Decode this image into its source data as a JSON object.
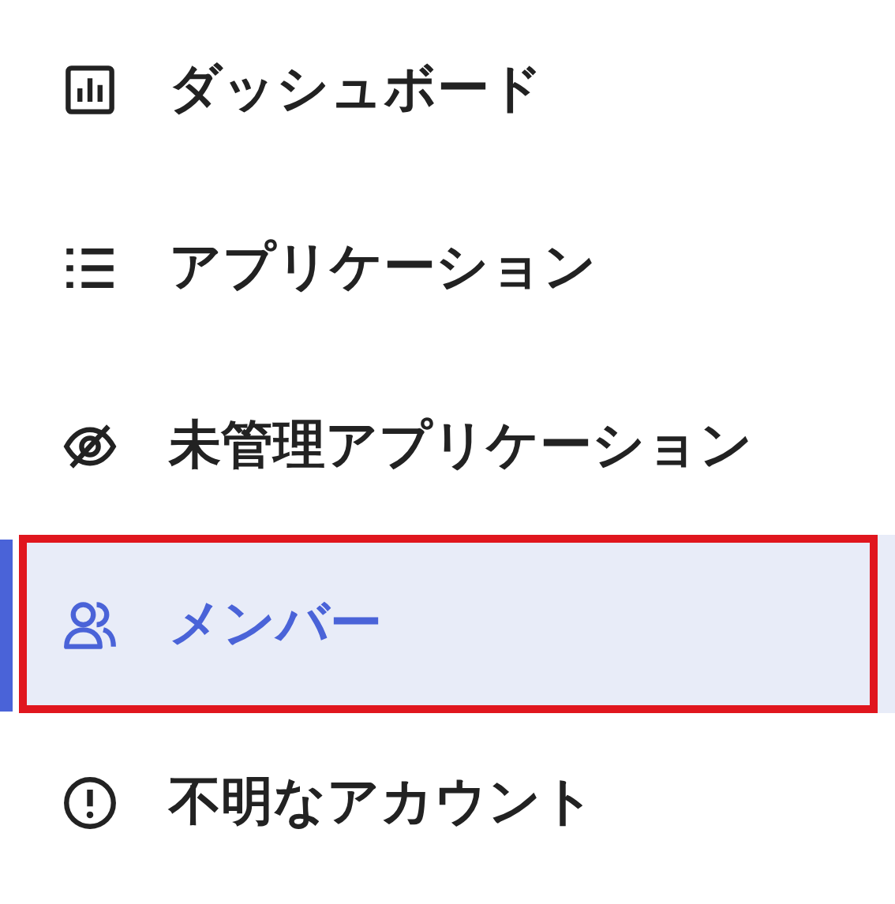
{
  "sidebar": {
    "items": [
      {
        "label": "ダッシュボード",
        "selected": false,
        "highlighted": false
      },
      {
        "label": "アプリケーション",
        "selected": false,
        "highlighted": false
      },
      {
        "label": "未管理アプリケーション",
        "selected": false,
        "highlighted": false
      },
      {
        "label": "メンバー",
        "selected": true,
        "highlighted": true
      },
      {
        "label": "不明なアカウント",
        "selected": false,
        "highlighted": false
      }
    ]
  }
}
